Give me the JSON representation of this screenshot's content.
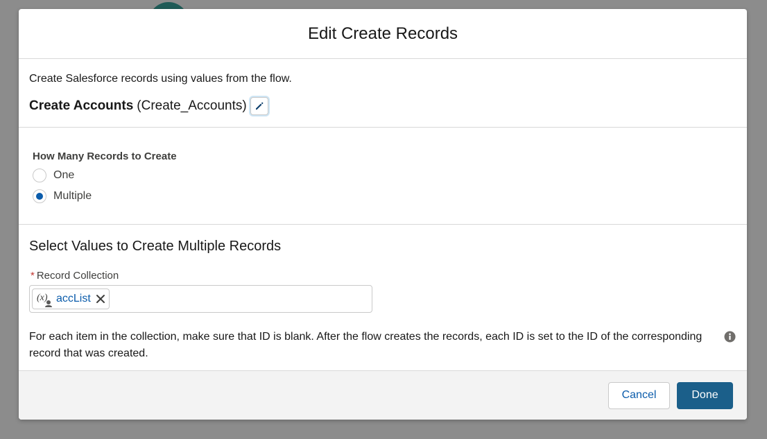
{
  "modal": {
    "title": "Edit Create Records"
  },
  "intro": {
    "description": "Create Salesforce records using values from the flow.",
    "element_label": "Create Accounts",
    "element_api_name": "(Create_Accounts)",
    "edit_icon": "pencil-icon"
  },
  "how_many": {
    "title": "How Many Records to Create",
    "options": [
      {
        "label": "One",
        "selected": false
      },
      {
        "label": "Multiple",
        "selected": true
      }
    ]
  },
  "values_section": {
    "title": "Select Values to Create Multiple Records",
    "record_collection": {
      "required_marker": "*",
      "label": "Record Collection",
      "pill_icon": "variable-icon",
      "pill_value": "accList",
      "remove_icon": "close-icon"
    },
    "help_text": "For each item in the collection, make sure that ID is blank. After the flow creates the records, each ID is set to the ID of the corresponding record that was created.",
    "info_icon": "info-icon"
  },
  "footer": {
    "cancel_label": "Cancel",
    "done_label": "Done"
  },
  "colors": {
    "brand_blue": "#1b5f8a",
    "link_blue": "#0b5cab",
    "required_red": "#c23934",
    "overlay": "#8c8c8c"
  }
}
